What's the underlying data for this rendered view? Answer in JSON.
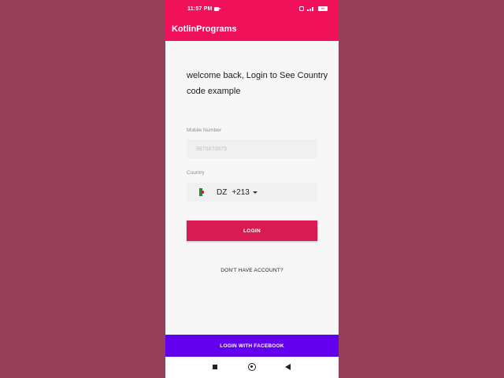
{
  "status_bar": {
    "time": "11:57 PM",
    "battery": "89"
  },
  "app_bar": {
    "title": "KotlinPrograms"
  },
  "login_screen": {
    "welcome_text": "welcome back, Login to See Country code example",
    "mobile_label": "Mobile Number",
    "mobile_placeholder": "9876879879",
    "country_label": "Country",
    "country_code": "DZ",
    "dial_code": "+213",
    "login_button": "LOGIN",
    "no_account_link": "DON'T HAVE ACCOUNT?",
    "facebook_button": "LOGIN WITH FACEBOOK"
  },
  "colors": {
    "app_bar": "#f0115a",
    "login_button": "#d81b53",
    "facebook_button": "#6200ee",
    "background": "#963f5b"
  },
  "icons": {
    "status": [
      "video-camera-icon",
      "alarm-icon",
      "signal-icon",
      "battery-icon"
    ],
    "country_flag": "algeria-flag-icon",
    "dropdown": "caret-down-icon",
    "navigation": [
      "recents-icon",
      "home-icon",
      "back-icon"
    ]
  }
}
